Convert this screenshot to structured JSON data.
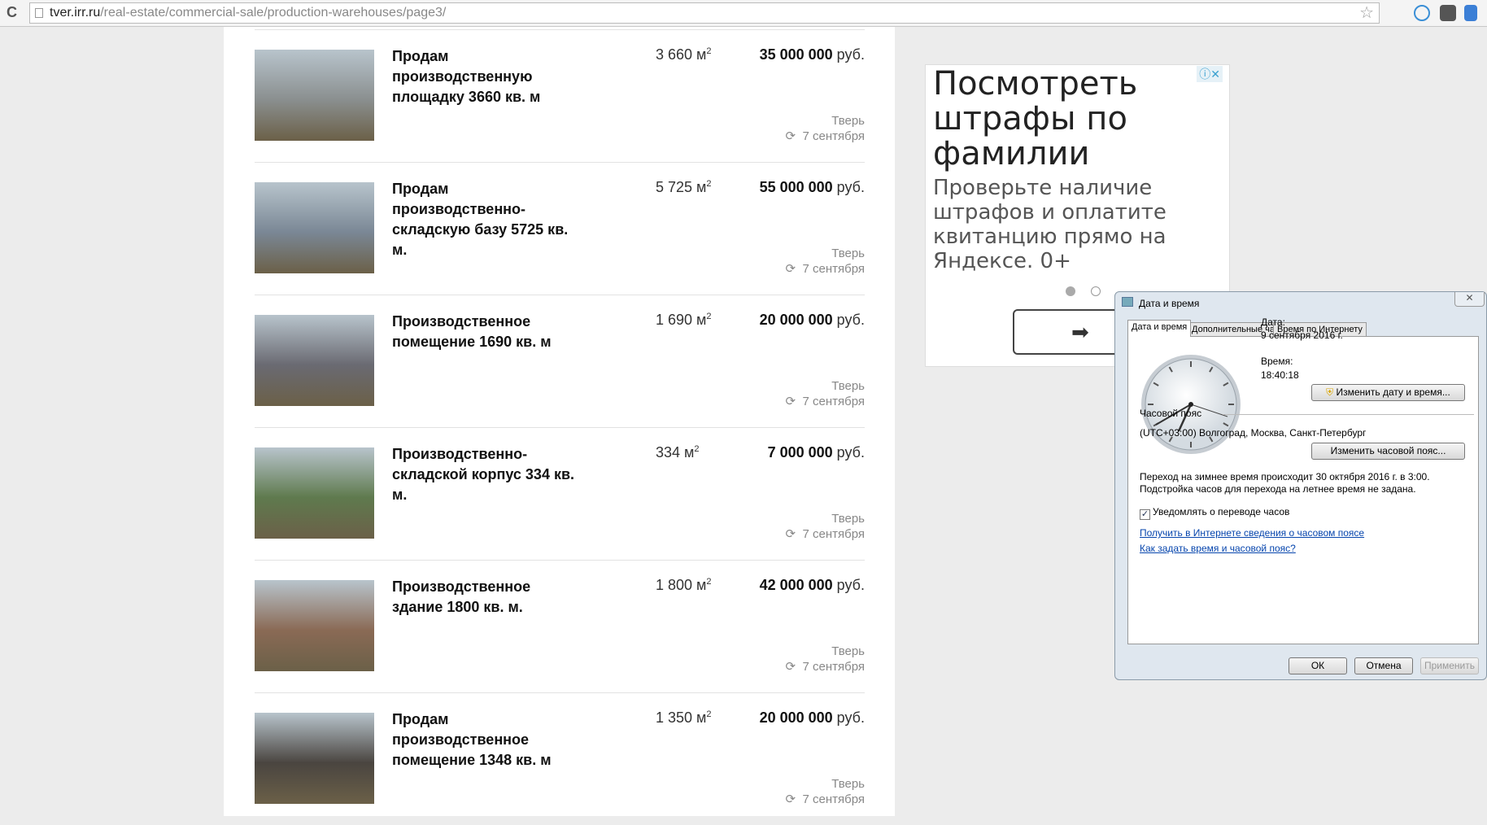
{
  "browser": {
    "url_host": "tver.irr.ru",
    "url_path": "/real-estate/commercial-sale/production-warehouses/page3/"
  },
  "listings": [
    {
      "title": "Продам производственную площадку 3660 кв. м",
      "area": "3 660 м",
      "price": "35 000 000",
      "currency": "руб.",
      "city": "Тверь",
      "date": "7 сентября",
      "photo_color": "#8a8f8f"
    },
    {
      "title": "Продам производственно-складскую базу 5725 кв. м.",
      "area": "5 725 м",
      "price": "55 000 000",
      "currency": "руб.",
      "city": "Тверь",
      "date": "7 сентября",
      "photo_color": "#7a8795"
    },
    {
      "title": "Производственное помещение 1690 кв. м",
      "area": "1 690 м",
      "price": "20 000 000",
      "currency": "руб.",
      "city": "Тверь",
      "date": "7 сентября",
      "photo_color": "#6a6a72"
    },
    {
      "title": "Производственно-складской корпус 334 кв. м.",
      "area": "334 м",
      "price": "7 000 000",
      "currency": "руб.",
      "city": "Тверь",
      "date": "7 сентября",
      "photo_color": "#5f7a4e"
    },
    {
      "title": "Производственное здание 1800 кв. м.",
      "area": "1 800 м",
      "price": "42 000 000",
      "currency": "руб.",
      "city": "Тверь",
      "date": "7 сентября",
      "photo_color": "#8a6a55"
    },
    {
      "title": "Продам производственное помещение 1348 кв. м",
      "area": "1 350 м",
      "price": "20 000 000",
      "currency": "руб.",
      "city": "Тверь",
      "date": "7 сентября",
      "photo_color": "#4a4540"
    }
  ],
  "area_sup": "2",
  "ad": {
    "headline": "Посмотреть штрафы по фамилии",
    "text": "Проверьте наличие штрафов и оплатите квитанцию прямо на Яндексе. 0+",
    "button_icon": "arrow-right-icon"
  },
  "dialog": {
    "title": "Дата и время",
    "tabs": [
      "Дата и время",
      "Дополнительные часы",
      "Время по Интернету"
    ],
    "date_label": "Дата:",
    "date_value": "9 сентября 2016 г.",
    "time_label": "Время:",
    "time_value": "18:40:18",
    "change_datetime": "Изменить дату и время...",
    "tz_label": "Часовой пояс",
    "tz_value": "(UTC+03:00) Волгоград, Москва, Санкт-Петербург",
    "change_tz": "Изменить часовой пояс...",
    "dst_line1": "Переход на зимнее время происходит 30 октября 2016 г. в 3:00.",
    "dst_line2": "Подстройка часов для перехода на летнее время не задана.",
    "notify_label": "Уведомлять о переводе часов",
    "notify_checked": true,
    "link1": "Получить в Интернете сведения о часовом поясе",
    "link2": "Как задать время и часовой пояс?",
    "ok": "ОК",
    "cancel": "Отмена",
    "apply": "Применить"
  }
}
